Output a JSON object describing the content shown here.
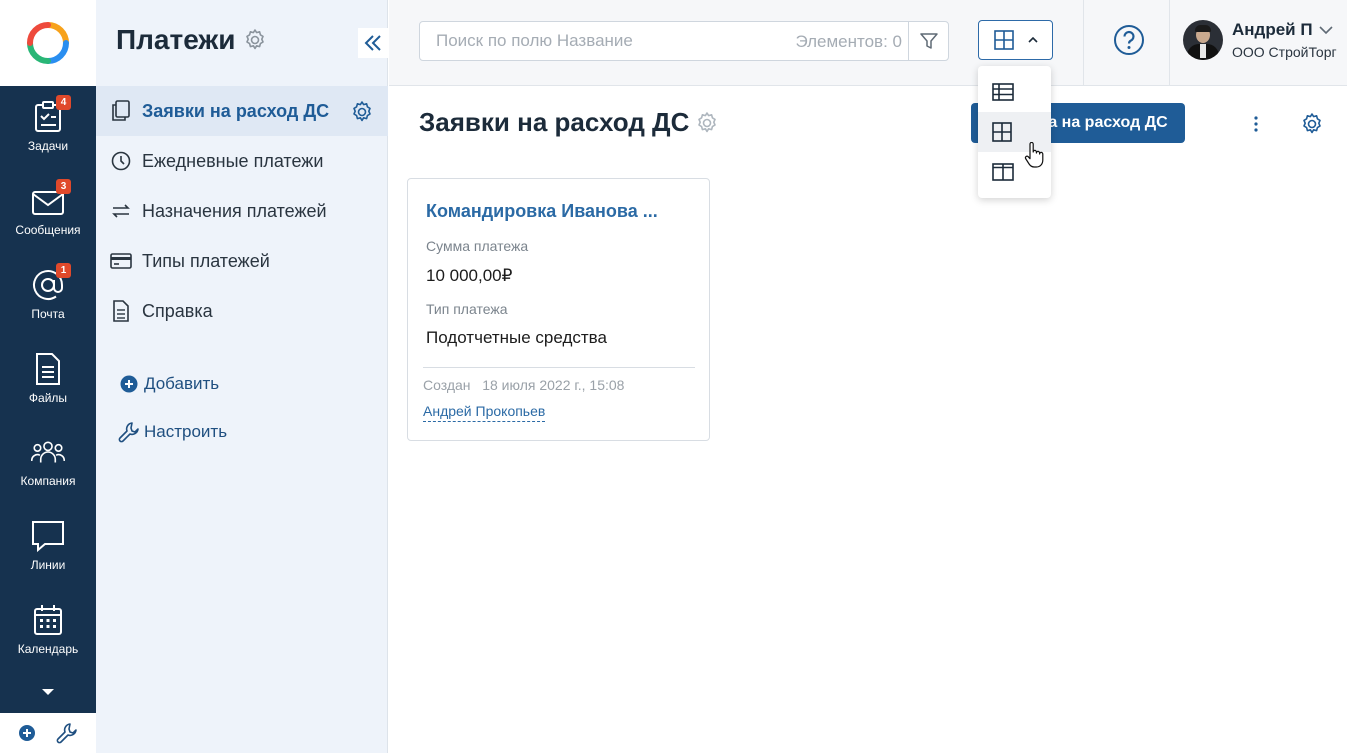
{
  "app": {
    "logo": "elma-logo-icon",
    "colors": {
      "rail": "#16324f",
      "accent": "#1f5c97",
      "badge": "#e0492b",
      "sidebar": "#eef3fa"
    }
  },
  "rail": {
    "items": [
      {
        "label": "Задачи",
        "icon": "tasks-icon",
        "badge": "4"
      },
      {
        "label": "Сообщения",
        "icon": "messages-icon",
        "badge": "3"
      },
      {
        "label": "Почта",
        "icon": "mail-icon",
        "badge": "1"
      },
      {
        "label": "Файлы",
        "icon": "files-icon",
        "badge": ""
      },
      {
        "label": "Компания",
        "icon": "company-icon",
        "badge": ""
      },
      {
        "label": "Линии",
        "icon": "lines-icon",
        "badge": ""
      },
      {
        "label": "Календарь",
        "icon": "calendar-icon",
        "badge": ""
      }
    ]
  },
  "sidebar": {
    "title": "Платежи",
    "items": [
      {
        "label": "Заявки на расход ДС",
        "icon": "copy-icon",
        "active": true
      },
      {
        "label": "Ежедневные платежи",
        "icon": "clock-icon",
        "active": false
      },
      {
        "label": "Назначения платежей",
        "icon": "arrows-icon",
        "active": false
      },
      {
        "label": "Типы платежей",
        "icon": "card-icon",
        "active": false
      },
      {
        "label": "Справка",
        "icon": "document-icon",
        "active": false
      }
    ],
    "add_label": "Добавить",
    "configure_label": "Настроить"
  },
  "topbar": {
    "search_placeholder": "Поиск по полю Название",
    "count_text": "Элементов: 0"
  },
  "user": {
    "name": "Андрей П",
    "org": "ООО СтройТорг"
  },
  "main": {
    "title": "Заявки на расход ДС",
    "create_label": "а на расход ДС"
  },
  "card": {
    "title": "Командировка Иванова ...",
    "amount_label": "Сумма платежа",
    "amount_value": "10 000,00₽",
    "type_label": "Тип платежа",
    "type_value": "Подотчетные средства",
    "created_label": "Создан",
    "created_date": "18 июля 2022 г., 15:08",
    "author": "Андрей Прокопьев"
  },
  "view_menu": {
    "options": [
      "table-view-icon",
      "grid-view-icon",
      "split-view-icon"
    ],
    "hovered": "grid-view-icon"
  }
}
